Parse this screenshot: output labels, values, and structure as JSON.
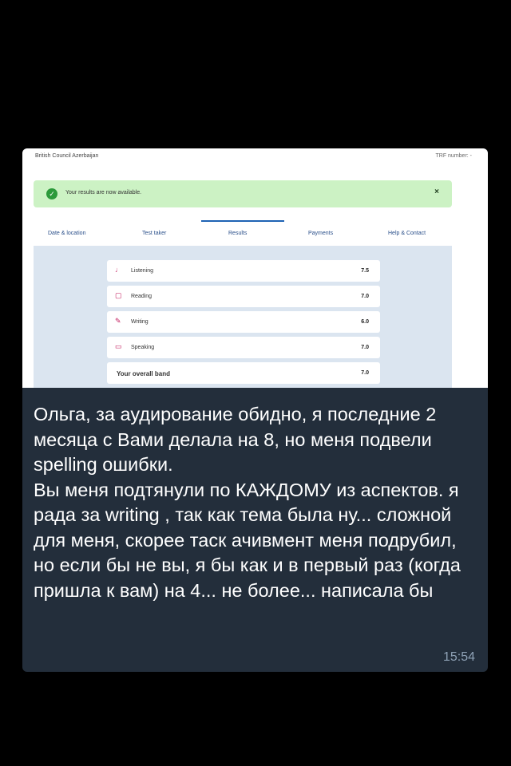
{
  "screenshot": {
    "header": {
      "org": "British Council Azerbaijan",
      "trf": "TRF number: -"
    },
    "banner": {
      "message": "Your results are now available.",
      "close_icon": "close-icon",
      "color": "#ccf2c4"
    },
    "tabs": [
      {
        "label": "Date & location"
      },
      {
        "label": "Test taker"
      },
      {
        "label": "Results",
        "active": true
      },
      {
        "label": "Payments"
      },
      {
        "label": "Help & Contact"
      }
    ],
    "results": [
      {
        "icon": "headphones-icon",
        "label": "Listening",
        "score": "7.5"
      },
      {
        "icon": "book-icon",
        "label": "Reading",
        "score": "7.0"
      },
      {
        "icon": "pen-icon",
        "label": "Writing",
        "score": "6.0"
      },
      {
        "icon": "speech-bubble-icon",
        "label": "Speaking",
        "score": "7.0"
      }
    ],
    "overall": {
      "label": "Your overall band",
      "score": "7.0"
    }
  },
  "message": {
    "text": "Ольга, за аудирование обидно, я последние 2 месяца с Вами делала на 8, но меня подвели spelling ошибки.\nВы меня подтянули по КАЖДОМУ из аспектов.  я рада за writing , так как тема была ну... сложной для меня, скорее таск ачивмент меня подрубил, но если бы не вы, я бы как и в первый раз (когда пришла к вам) на 4... не более... написала бы",
    "time": "15:54"
  }
}
